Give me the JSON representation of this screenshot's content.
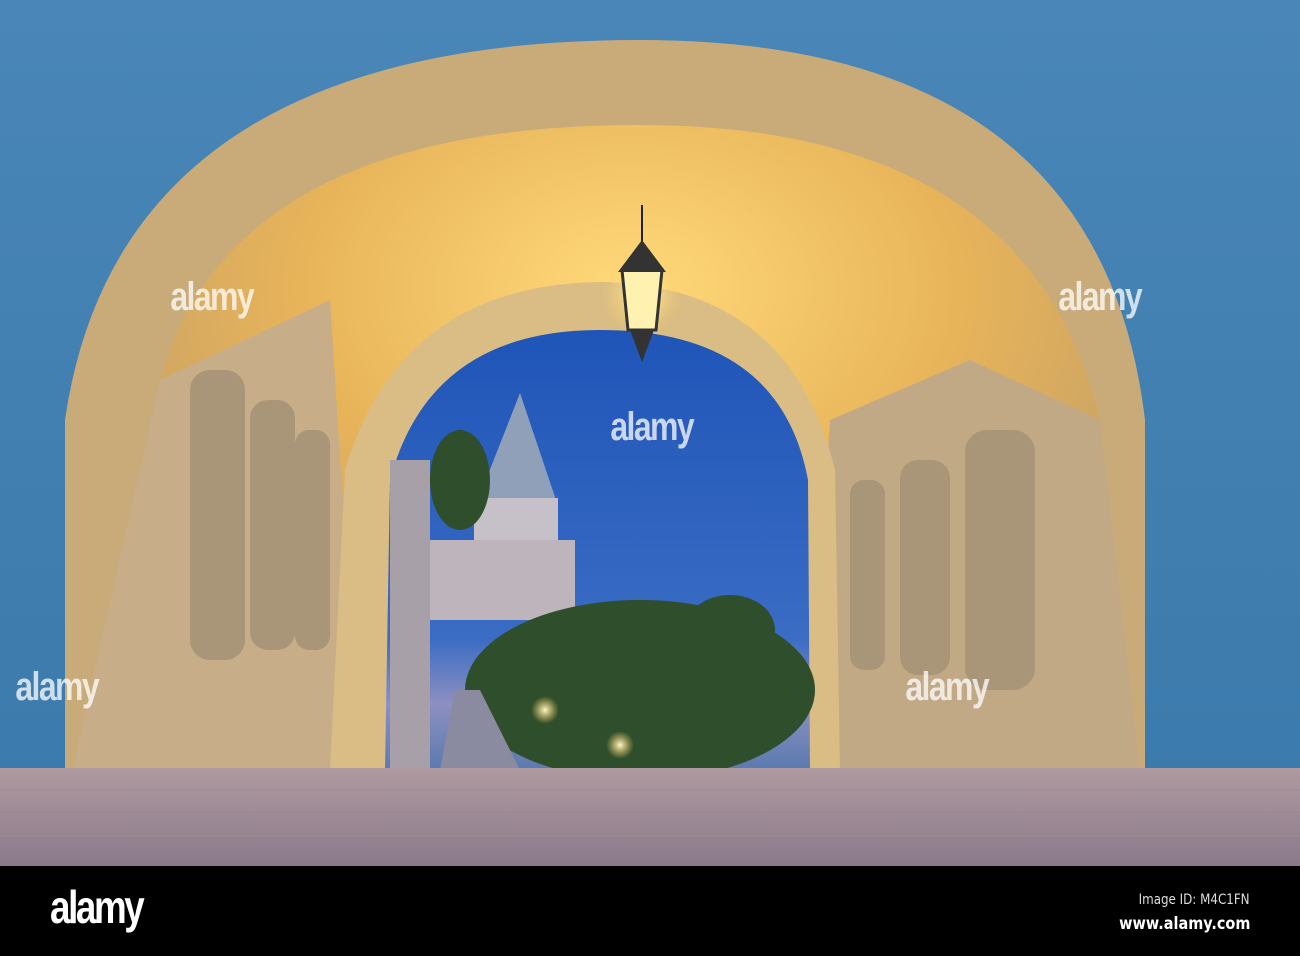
{
  "photo": {
    "subject": "Fisherman's Bastion arch at dusk"
  },
  "watermark": {
    "text": "alamy"
  },
  "footer": {
    "logo": "alamy",
    "image_id": "Image ID: M4C1FN",
    "website": "www.alamy.com"
  }
}
